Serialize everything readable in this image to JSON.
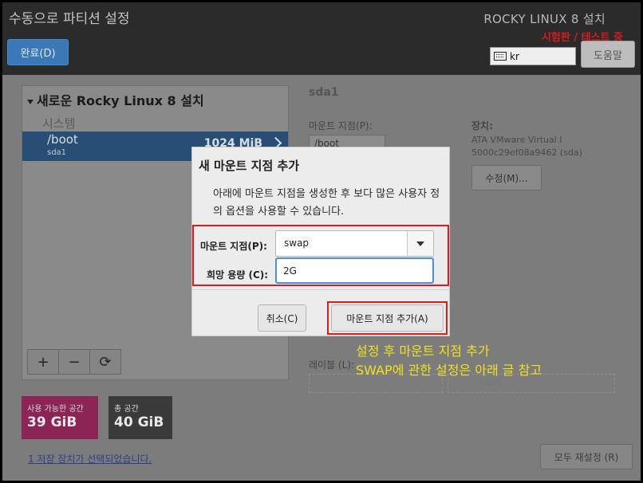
{
  "header": {
    "title": "수동으로 파티션 설정",
    "done_label": "완료(D)",
    "product": "ROCKY LINUX 8 설치",
    "prerelease": "시험판 / 테스트 중",
    "keyboard_layout": "kr",
    "help_label": "도움말"
  },
  "left": {
    "install_title": "새로운 Rocky Linux 8 설치",
    "group_label": "시스템",
    "partition": {
      "name": "/boot",
      "device": "sda1",
      "size": "1024 MiB"
    },
    "tools": {
      "add": "+",
      "remove": "−",
      "refresh": "⟳"
    }
  },
  "space": {
    "available_label": "사용 가능한 공간",
    "available_value": "39 GiB",
    "total_label": "총 공간",
    "total_value": "40 GiB"
  },
  "storage_link": "1 저장 장치가 선택되었습니다.",
  "right": {
    "title": "sda1",
    "mount_label": "마운트 지점(P):",
    "mount_value": "/boot",
    "device_label": "장치:",
    "device_line1": "ATA VMware Virtual I",
    "device_line2": "5000c29ef08a9462 (sda)",
    "modify_label": "수정(M)...",
    "label_label": "레이블 (L):",
    "name_value": "sda1",
    "reset_label": "모두 재설정 (R)"
  },
  "dialog": {
    "title": "새 마운트 지점 추가",
    "description": "아래에 마운트 지점을 생성한 후 보다 많은 사용자 정의 옵션을 사용할 수 있습니다.",
    "mount_label": "마운트 지점(P):",
    "mount_value": "swap",
    "capacity_label": "희망 용량 (C):",
    "capacity_value": "2G",
    "cancel_label": "취소(C)",
    "add_label": "마운트 지점 추가(A)"
  },
  "annotation": {
    "line1": "설정 후 마운트 지점 추가",
    "line2": "SWAP에 관한 설정은 아래 글 참고"
  },
  "colors": {
    "highlight": "#e01a1a",
    "annotation": "#f0e020",
    "selected_row": "#284e75",
    "available_space": "#8c2456"
  }
}
